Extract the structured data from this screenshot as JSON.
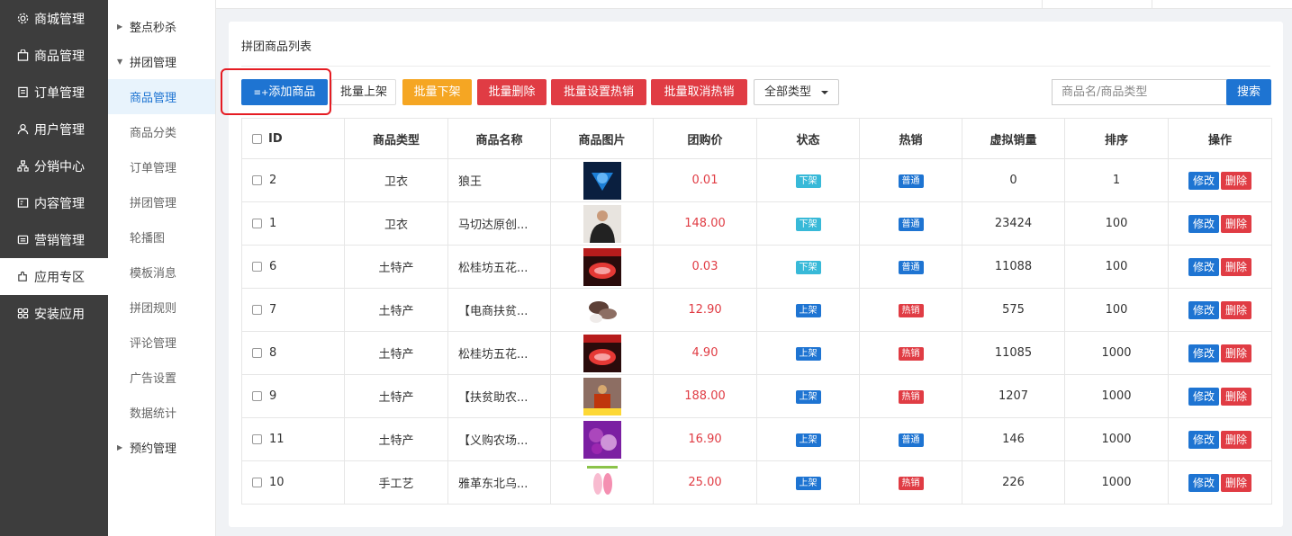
{
  "nav1": [
    {
      "label": "商城管理",
      "icon": "gear-icon"
    },
    {
      "label": "商品管理",
      "icon": "bag-icon"
    },
    {
      "label": "订单管理",
      "icon": "order-icon"
    },
    {
      "label": "用户管理",
      "icon": "user-icon"
    },
    {
      "label": "分销中心",
      "icon": "network-icon"
    },
    {
      "label": "内容管理",
      "icon": "content-icon"
    },
    {
      "label": "营销管理",
      "icon": "marketing-icon"
    },
    {
      "label": "应用专区",
      "icon": "puzzle-icon"
    },
    {
      "label": "安装应用",
      "icon": "grid-icon"
    }
  ],
  "nav2": {
    "group1": "整点秒杀",
    "group2": "拼团管理",
    "items": [
      "商品管理",
      "商品分类",
      "订单管理",
      "拼团管理",
      "轮播图",
      "模板消息",
      "拼团规则",
      "评论管理",
      "广告设置",
      "数据统计"
    ],
    "group3": "预约管理"
  },
  "panel": {
    "title": "拼团商品列表"
  },
  "toolbar": {
    "add": "添加商品",
    "batch_up": "批量上架",
    "batch_down": "批量下架",
    "batch_delete": "批量删除",
    "batch_set_hot": "批量设置热销",
    "batch_cancel_hot": "批量取消热销",
    "type_select": "全部类型",
    "search_placeholder": "商品名/商品类型",
    "search": "搜索"
  },
  "table": {
    "headers": [
      "ID",
      "商品类型",
      "商品名称",
      "商品图片",
      "团购价",
      "状态",
      "热销",
      "虚拟销量",
      "排序",
      "操作"
    ],
    "edit_label": "修改",
    "delete_label": "删除",
    "rows": [
      {
        "id": "2",
        "type": "卫衣",
        "name": "狼王",
        "price": "0.01",
        "status": "下架",
        "hot": "普通",
        "sales": "0",
        "sort": "1",
        "img": "blue"
      },
      {
        "id": "1",
        "type": "卫衣",
        "name": "马切达原创...",
        "price": "148.00",
        "status": "下架",
        "hot": "普通",
        "sales": "23424",
        "sort": "100",
        "img": "person"
      },
      {
        "id": "6",
        "type": "土特产",
        "name": "松桂坊五花...",
        "price": "0.03",
        "status": "下架",
        "hot": "普通",
        "sales": "11088",
        "sort": "100",
        "img": "meat"
      },
      {
        "id": "7",
        "type": "土特产",
        "name": "【电商扶贫...",
        "price": "12.90",
        "status": "上架",
        "hot": "热销",
        "sales": "575",
        "sort": "100",
        "img": "mushroom"
      },
      {
        "id": "8",
        "type": "土特产",
        "name": "松桂坊五花...",
        "price": "4.90",
        "status": "上架",
        "hot": "热销",
        "sales": "11085",
        "sort": "1000",
        "img": "meat"
      },
      {
        "id": "9",
        "type": "土特产",
        "name": "【扶贫助农...",
        "price": "188.00",
        "status": "上架",
        "hot": "热销",
        "sales": "1207",
        "sort": "1000",
        "img": "market"
      },
      {
        "id": "11",
        "type": "土特产",
        "name": "【义购农场...",
        "price": "16.90",
        "status": "上架",
        "hot": "普通",
        "sales": "146",
        "sort": "1000",
        "img": "purple"
      },
      {
        "id": "10",
        "type": "手工艺",
        "name": "雅革东北乌...",
        "price": "25.00",
        "status": "上架",
        "hot": "热销",
        "sales": "226",
        "sort": "1000",
        "img": "insole"
      }
    ]
  }
}
